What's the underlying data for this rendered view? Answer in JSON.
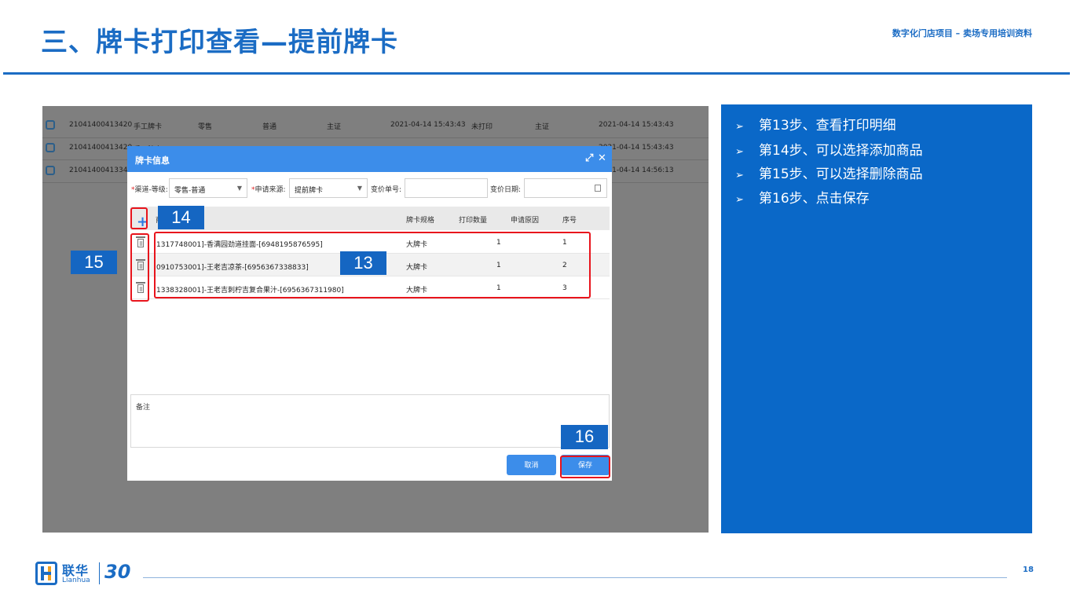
{
  "slide": {
    "title": "三、牌卡打印查看—提前牌卡",
    "subtitle": "数字化门店项目 – 卖场专用培训资料",
    "page_number": "18"
  },
  "background_rows": [
    {
      "code": "21041400413420",
      "type": "手工牌卡",
      "channel": "零售",
      "level": "普通",
      "scope": "主证",
      "date": "2021-04-14 15:43:43",
      "status": "未打印",
      "scope2": "主证",
      "date2": "2021-04-14 15:43:43"
    },
    {
      "code": "21041400413420",
      "type": "手工牌卡",
      "channel": "",
      "level": "",
      "scope": "",
      "date": "",
      "status": "",
      "scope2": "",
      "date2": "2021-04-14 15:43:43"
    },
    {
      "code": "21041400413346",
      "type": "",
      "channel": "",
      "level": "",
      "scope": "",
      "date": "",
      "status": "",
      "scope2": "",
      "date2": "2021-04-14 14:56:13"
    }
  ],
  "dialog": {
    "title": "牌卡信息",
    "fields": {
      "channel_label": "渠道-等级:",
      "channel_value": "零售-普通",
      "source_label": "申请来源:",
      "source_value": "提前牌卡",
      "price_no_label": "变价单号:",
      "price_no_value": "",
      "price_date_label": "变价日期:",
      "price_date_value": ""
    },
    "columns": [
      "商",
      "牌卡规格",
      "打印数量",
      "申请原因",
      "序号"
    ],
    "rows": [
      {
        "product": "1317748001]-香满园劲道挂面-[6948195876595]",
        "spec": "大牌卡",
        "qty": "1",
        "reason": "",
        "seq": "1"
      },
      {
        "product": "0910753001]-王老吉凉茶-[6956367338833]",
        "spec": "大牌卡",
        "qty": "1",
        "reason": "",
        "seq": "2"
      },
      {
        "product": "1338328001]-王老吉刺柠吉复合果汁-[6956367311980]",
        "spec": "大牌卡",
        "qty": "1",
        "reason": "",
        "seq": "3"
      }
    ],
    "remark_label": "备注",
    "cancel_label": "取消",
    "save_label": "保存"
  },
  "callouts": {
    "c13": "13",
    "c14": "14",
    "c15": "15",
    "c16": "16"
  },
  "steps": [
    "第13步、查看打印明细",
    "第14步、可以选择添加商品",
    "第15步、可以选择删除商品",
    "第16步、点击保存"
  ],
  "logo": {
    "cn": "联华",
    "en": "Lianhua",
    "anniversary": "30"
  },
  "colors": {
    "brand_blue": "#1b6cc4",
    "panel_blue": "#0a68c8",
    "dialog_header": "#3c8dea",
    "highlight_red": "#e8141c"
  }
}
